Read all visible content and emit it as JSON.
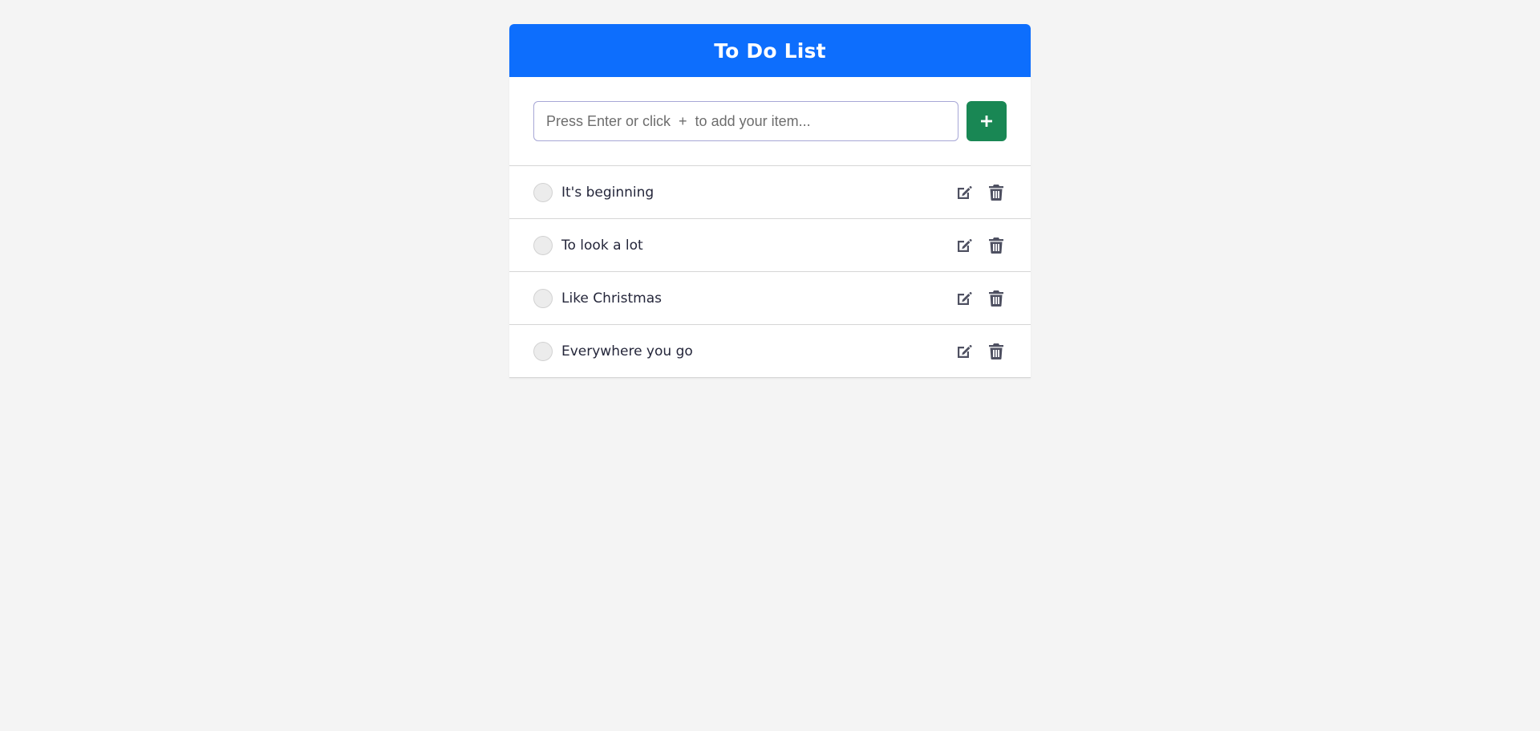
{
  "header": {
    "title": "To Do List"
  },
  "add": {
    "placeholder": "Press Enter or click  +  to add your item...",
    "value": "",
    "button_icon": "plus-icon"
  },
  "items": [
    {
      "text": "It's beginning",
      "completed": false
    },
    {
      "text": "To look a lot",
      "completed": false
    },
    {
      "text": "Like Christmas",
      "completed": false
    },
    {
      "text": "Everywhere you go",
      "completed": false
    }
  ],
  "item_actions": {
    "edit_icon": "edit-icon",
    "delete_icon": "trash-icon"
  },
  "colors": {
    "header_bg": "#0d6efd",
    "add_button_bg": "#198754",
    "page_bg": "#f4f4f4",
    "icon_color": "#4e5061",
    "text_color": "#24263a"
  }
}
